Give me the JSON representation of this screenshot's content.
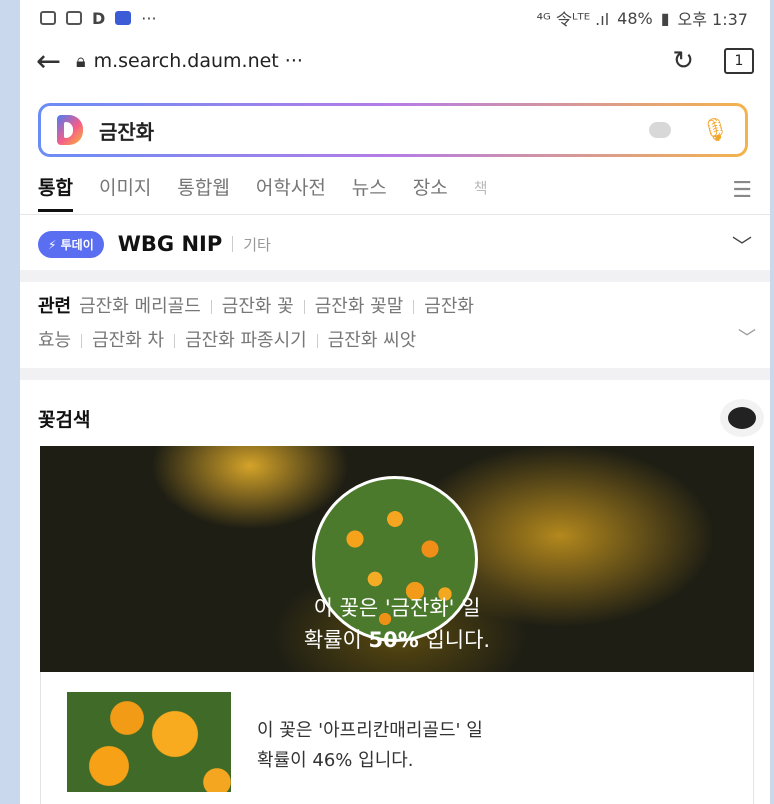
{
  "status_bar": {
    "left_icons": [
      "facebook-icon",
      "gallery-icon",
      "daum-icon",
      "messenger-icon"
    ],
    "more": "···",
    "network": "⁴ᴳ 令ᴸᵀᴱ .ıl",
    "battery": "48%",
    "time": "오후 1:37"
  },
  "url_bar": {
    "url": "m.search.daum.net ···",
    "tab_count": "1"
  },
  "search": {
    "query": "금잔화"
  },
  "nav_tabs": [
    {
      "label": "통합",
      "active": true
    },
    {
      "label": "이미지"
    },
    {
      "label": "통합웹"
    },
    {
      "label": "어학사전"
    },
    {
      "label": "뉴스"
    },
    {
      "label": "장소"
    },
    {
      "label": "책"
    }
  ],
  "today": {
    "badge": "투데이",
    "title": "WBG NIP",
    "etc": "기타"
  },
  "related": {
    "title": "관련",
    "items": [
      "금잔화 메리골드",
      "금잔화 꽃",
      "금잔화 꽃말",
      "금잔화 효능",
      "금잔화 차",
      "금잔화 파종시기",
      "금잔화 씨앗"
    ],
    "row1_last": "금잔화",
    "row2_first": "효능"
  },
  "flower": {
    "section_title": "꽃검색",
    "hero_line1": "이 꽃은 '금잔화' 일",
    "hero_line2_prefix": "확률이 ",
    "hero_percent": "50%",
    "hero_line2_suffix": " 입니다.",
    "result_line1": "이 꽃은 '아프리칸매리골드' 일",
    "result_line2": "확률이 46% 입니다."
  }
}
